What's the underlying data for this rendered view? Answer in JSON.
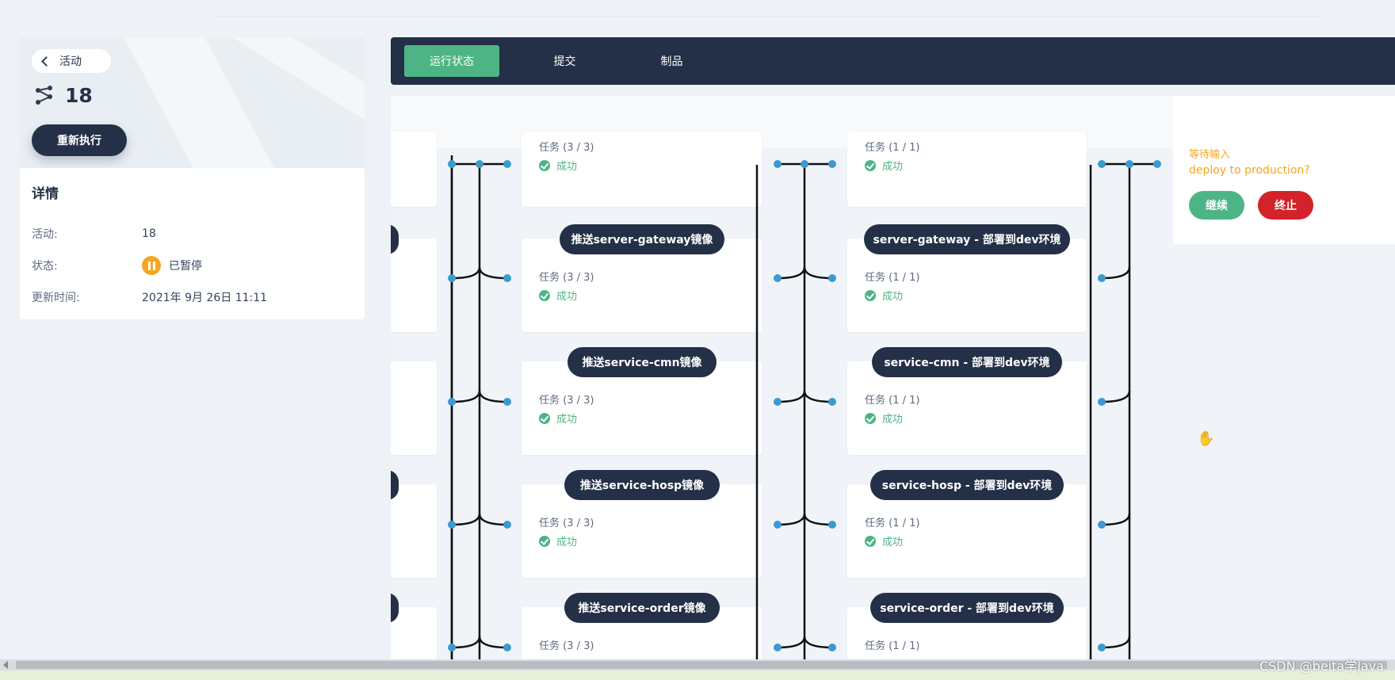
{
  "nav": {
    "back_label": "活动"
  },
  "run": {
    "id": "18",
    "rerun_label": "重新执行"
  },
  "details": {
    "title": "详情",
    "rows": [
      {
        "key": "活动:",
        "value": "18"
      },
      {
        "key": "状态:",
        "value": "已暂停"
      },
      {
        "key": "更新时间:",
        "value": "2021年 9月 26日 11:11"
      }
    ]
  },
  "tabs": [
    "运行状态",
    "提交",
    "制品"
  ],
  "pipeline": {
    "push_stages": [
      {
        "name": "",
        "tasks": "任务 (3 / 3)",
        "status": "成功"
      },
      {
        "name": "推送server-gateway镜像",
        "tasks": "任务 (3 / 3)",
        "status": "成功"
      },
      {
        "name": "推送service-cmn镜像",
        "tasks": "任务 (3 / 3)",
        "status": "成功"
      },
      {
        "name": "推送service-hosp镜像",
        "tasks": "任务 (3 / 3)",
        "status": "成功"
      },
      {
        "name": "推送service-order镜像",
        "tasks": "任务 (3 / 3)",
        "status": ""
      }
    ],
    "deploy_stages": [
      {
        "name": "",
        "tasks": "任务 (1 / 1)",
        "status": "成功"
      },
      {
        "name": "server-gateway - 部署到dev环境",
        "tasks": "任务 (1 / 1)",
        "status": "成功"
      },
      {
        "name": "service-cmn - 部署到dev环境",
        "tasks": "任务 (1 / 1)",
        "status": "成功"
      },
      {
        "name": "service-hosp - 部署到dev环境",
        "tasks": "任务 (1 / 1)",
        "status": "成功"
      },
      {
        "name": "service-order - 部署到dev环境",
        "tasks": "任务 (1 / 1)",
        "status": ""
      }
    ]
  },
  "approval": {
    "waiting": "等待输入",
    "question": "deploy to production?",
    "continue_label": "继续",
    "abort_label": "终止"
  },
  "watermark": "CSDN @beita学Java",
  "colors": {
    "accent": "#4db585",
    "navy": "#243047",
    "node": "#3b9ad0",
    "warn": "#f5a623",
    "danger": "#d3222a"
  }
}
